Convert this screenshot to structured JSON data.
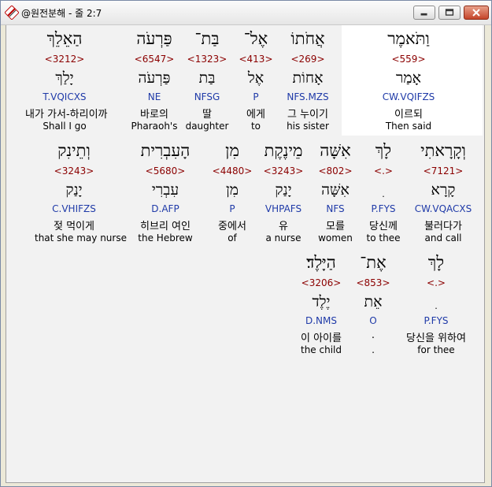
{
  "window": {
    "title": "@원전분해 - 줄 2:7",
    "colors": {
      "strong": "#8b0000",
      "parse": "#1f3aa8",
      "highlight": "#ffffff"
    }
  },
  "rows": [
    [
      {
        "heb": "וַתֹּאמֶר",
        "strong": "<559>",
        "lex": "אָמַר",
        "parse": "CW.VQIFZS",
        "kor": "이르되",
        "eng": "Then said"
      },
      {
        "heb": "אֲחֹתוֹ",
        "strong": "<269>",
        "lex": "אָחוֹת",
        "parse": "NFS.MZS",
        "kor": "그 누이기",
        "eng": "his sister"
      },
      {
        "heb": "אֶל־",
        "strong": "<413>",
        "lex": "אֶל",
        "parse": "P",
        "kor": "에게",
        "eng": "to"
      },
      {
        "heb": "בַּת־",
        "strong": "<1323>",
        "lex": "בַּת",
        "parse": "NFSG",
        "kor": "딸",
        "eng": "daughter"
      },
      {
        "heb": "פַּרְעֹה",
        "strong": "<6547>",
        "lex": "פַּרְעֹה",
        "parse": "NE",
        "kor": "바로의",
        "eng": "Pharaoh's"
      },
      {
        "heb": "הַאֵלֵךְ",
        "strong": "<3212>",
        "lex": "יָלַךְ",
        "parse": "T.VQICXS",
        "kor": "내가 가서-하리이까",
        "eng": "Shall I go"
      }
    ],
    [
      {
        "heb": "וְקָרָאתִי",
        "strong": "<7121>",
        "lex": "קָרָא",
        "parse": "CW.VQACXS",
        "kor": "불러다가",
        "eng": "and call"
      },
      {
        "heb": "לָךְ",
        "strong": "<.>",
        "lex": "ִ",
        "parse": "P.FYS",
        "kor": "당신께",
        "eng": "to thee"
      },
      {
        "heb": "אִשָּׁה",
        "strong": "<802>",
        "lex": "אִשָּׁה",
        "parse": "NFS",
        "kor": "모를",
        "eng": "women"
      },
      {
        "heb": "מֵינֶקֶת",
        "strong": "<3243>",
        "lex": "יָנַק",
        "parse": "VHPAFS",
        "kor": "유",
        "eng": "a nurse"
      },
      {
        "heb": "מִן",
        "strong": "<4480>",
        "lex": "מִן",
        "parse": "P",
        "kor": "중에서",
        "eng": "of"
      },
      {
        "heb": "הָעִבְרִית",
        "strong": "<5680>",
        "lex": "עִבְרִי",
        "parse": "D.AFP",
        "kor": "히브리 여인",
        "eng": "the Hebrew"
      },
      {
        "heb": "וְתֵינִק",
        "strong": "<3243>",
        "lex": "יָנַק",
        "parse": "C.VHIFZS",
        "kor": "젖 먹이게",
        "eng": "that she may nurse"
      }
    ],
    [
      {
        "heb": "לָךְ",
        "strong": "<.>",
        "lex": "ִ",
        "parse": "P.FYS",
        "kor": "당신을 위하여",
        "eng": "for thee"
      },
      {
        "heb": "אֶת־",
        "strong": "<853>",
        "lex": "אֵת",
        "parse": "O",
        "kor": ".",
        "eng": "."
      },
      {
        "heb": "הַיָּלֶד׃",
        "strong": "<3206>",
        "lex": "יֶלֶד",
        "parse": "D.NMS",
        "kor": "이 아이를",
        "eng": "the child"
      }
    ]
  ]
}
